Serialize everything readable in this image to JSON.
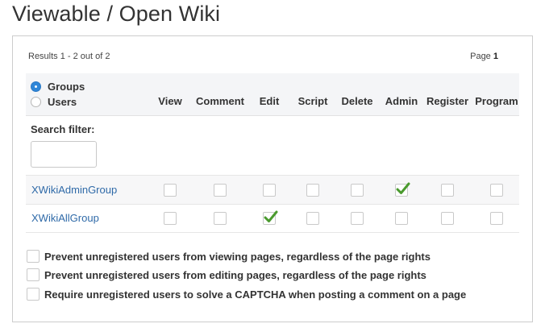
{
  "page": {
    "title": "Viewable / Open Wiki"
  },
  "results": {
    "summary": "Results 1 - 2 out of 2",
    "page_label": "Page",
    "page_number": "1"
  },
  "filter": {
    "groups_label": "Groups",
    "users_label": "Users",
    "selected": "Groups",
    "search_label": "Search filter:",
    "search_value": ""
  },
  "columns": [
    "View",
    "Comment",
    "Edit",
    "Script",
    "Delete",
    "Admin",
    "Register",
    "Program"
  ],
  "rows": [
    {
      "name": "XWikiAdminGroup",
      "rights": [
        false,
        false,
        false,
        false,
        false,
        true,
        false,
        false
      ]
    },
    {
      "name": "XWikiAllGroup",
      "rights": [
        false,
        false,
        true,
        false,
        false,
        false,
        false,
        false
      ]
    }
  ],
  "options": [
    {
      "label": "Prevent unregistered users from viewing pages, regardless of the page rights",
      "checked": false
    },
    {
      "label": "Prevent unregistered users from editing pages, regardless of the page rights",
      "checked": false
    },
    {
      "label": "Require unregistered users to solve a CAPTCHA when posting a comment on a page",
      "checked": false
    }
  ],
  "colors": {
    "link": "#2f6aa8",
    "check": "#4a9a2e",
    "radio_selected": "#2f86d8"
  }
}
